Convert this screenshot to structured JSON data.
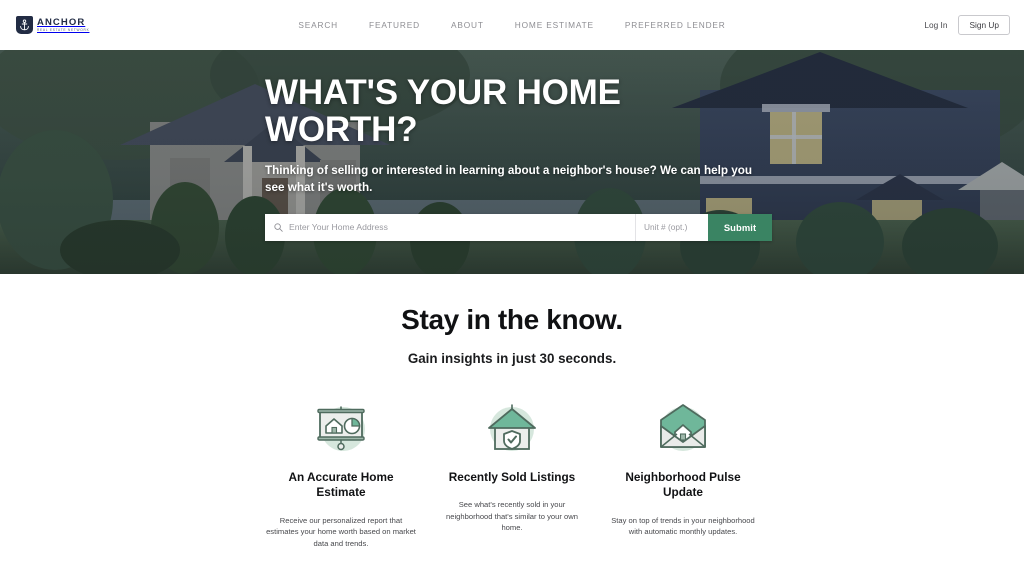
{
  "brand": {
    "icon": "anchor-icon",
    "name": "ANCHOR",
    "tagline": "REAL ESTATE NETWORK"
  },
  "nav": {
    "items": [
      {
        "label": "SEARCH"
      },
      {
        "label": "FEATURED"
      },
      {
        "label": "ABOUT"
      },
      {
        "label": "HOME ESTIMATE"
      },
      {
        "label": "PREFERRED LENDER"
      }
    ]
  },
  "auth": {
    "login_label": "Log In",
    "signup_label": "Sign Up"
  },
  "hero": {
    "title": "WHAT'S YOUR HOME WORTH?",
    "subtitle": "Thinking of selling or interested in learning about a neighbor's house? We can help you see what it's worth.",
    "search": {
      "search_icon": "search-icon",
      "address_placeholder": "Enter Your Home Address",
      "address_value": "",
      "unit_placeholder": "Unit # (opt.)",
      "unit_value": "",
      "submit_label": "Submit"
    }
  },
  "know": {
    "title": "Stay in the know.",
    "subtitle": "Gain insights in just 30 seconds."
  },
  "features": {
    "items": [
      {
        "icon": "presentation-chart-house-icon",
        "title": "An Accurate Home Estimate",
        "desc": "Receive our personalized report that estimates your home worth based on market data and trends."
      },
      {
        "icon": "house-shield-check-icon",
        "title": "Recently Sold Listings",
        "desc": "See what's recently sold in your neighborhood that's similar to your own home."
      },
      {
        "icon": "envelope-house-icon",
        "title": "Neighborhood Pulse Update",
        "desc": "Stay on top of trends in your neighborhood with automatic monthly updates."
      }
    ]
  },
  "colors": {
    "brand_navy": "#222c44",
    "accent_green": "#3a8463",
    "icon_circle": "#d6e7dd",
    "icon_teal": "#6fb79a",
    "page_bg": "#ffffff"
  }
}
